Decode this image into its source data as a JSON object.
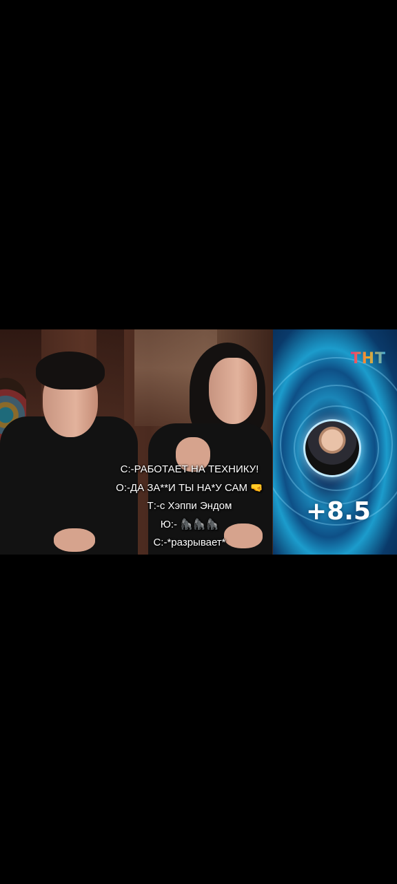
{
  "video": {
    "channel_logo": "ТНТ",
    "score": "+8.5",
    "captions": [
      "С:-РАБОТАЕТ НА ТЕХНИКУ!",
      "О:-ДА ЗА**И ТЫ НА*У САМ 🤜",
      "Т:-с Хэппи Эндом",
      "Ю:- 🦍🦍🦍",
      "С:-*разрывает*"
    ]
  },
  "colors": {
    "background": "#000000",
    "panel_blue": "#1a86b8",
    "caption_text": "#ffffff"
  }
}
